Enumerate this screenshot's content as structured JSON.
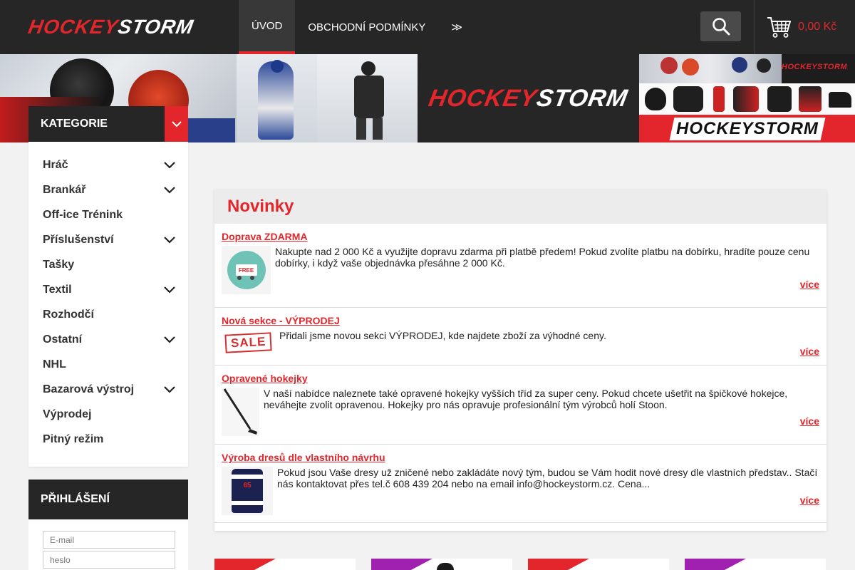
{
  "header": {
    "logo_part1": "HOCKEY",
    "logo_part2": "STORM",
    "nav": [
      {
        "label": "Úvod",
        "active": true
      },
      {
        "label": "Obchodní podmínky",
        "active": false
      },
      {
        "label": "≫",
        "active": false
      }
    ],
    "cart_total": "0,00 Kč"
  },
  "banner": {
    "logo_part1": "HOCKEY",
    "logo_part2": "STORM",
    "small_logo": "HOCKEYSTORM",
    "big_logo": "HOCKEYSTORM"
  },
  "sidebar": {
    "title": "KATEGORIE",
    "items": [
      {
        "label": "Hráč",
        "expandable": true
      },
      {
        "label": "Brankář",
        "expandable": true
      },
      {
        "label": "Off-ice Trénink",
        "expandable": false
      },
      {
        "label": "Příslušenství",
        "expandable": true
      },
      {
        "label": "Tašky",
        "expandable": false
      },
      {
        "label": "Textil",
        "expandable": true
      },
      {
        "label": "Rozhodčí",
        "expandable": false
      },
      {
        "label": "Ostatní",
        "expandable": true
      },
      {
        "label": "NHL",
        "expandable": false
      },
      {
        "label": "Bazarová výstroj",
        "expandable": true
      },
      {
        "label": "Výprodej",
        "expandable": false
      },
      {
        "label": "Pitný režim",
        "expandable": false
      }
    ]
  },
  "login": {
    "title": "PŘIHLÁŠENÍ",
    "email_placeholder": "E-mail",
    "password_placeholder": "heslo"
  },
  "news": {
    "title": "Novinky",
    "more_label": "více",
    "items": [
      {
        "title": "Doprava ZDARMA",
        "thumb_label": "FREE",
        "text": "Nakupte nad 2 000 Kč a využijte dopravu zdarma při platbě předem! Pokud zvolíte platbu na dobírku, hradíte pouze cenu dobírky, i když vaše objednávka přesáhne 2 000 Kč."
      },
      {
        "title": "Nová sekce - VÝPRODEJ",
        "thumb_label": "SALE",
        "text": "Přidali jsme novou sekci VÝPRODEJ, kde najdete zboží za výhodné ceny."
      },
      {
        "title": "Opravené hokejky",
        "text": "V naší nabídce naleznete také opravené hokejky vyšších tříd za super ceny. Pokud chcete ušetřit na špičkové hokejce, neváhejte zvolit opravenou. Hokejky pro nás opravuje profesionální tým výrobců holí Stoon."
      },
      {
        "title": "Výroba dresů dle vlastního návrhu",
        "thumb_label": "65",
        "text": "Pokud jsou Vaše dresy už zničené nebo zakládáte nový tým, budou se Vám hodit nové dresy dle vlastních představ.. Stačí nás kontaktovat přes tel.č 608 439 204 nebo na email info@hockeystorm.cz. Cena..."
      }
    ]
  },
  "colors": {
    "accent": "#e3262c",
    "dark": "#262626",
    "purple": "#a020b0"
  }
}
